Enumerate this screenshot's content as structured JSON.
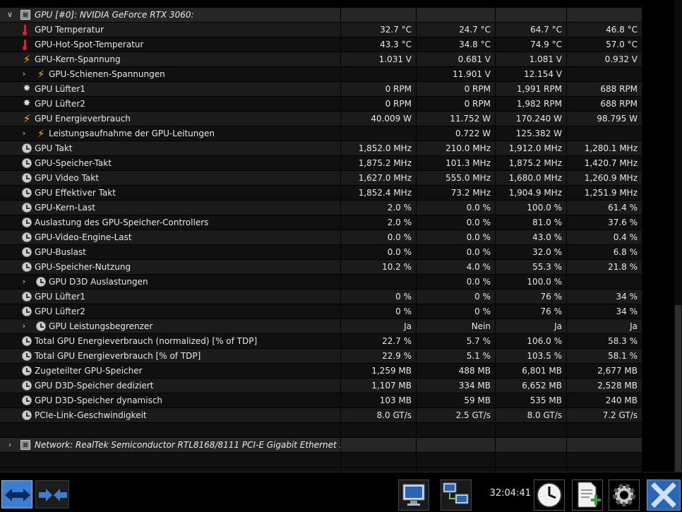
{
  "sensor_groups": {
    "gpu": {
      "title": "GPU [#0]: NVIDIA GeForce RTX 3060:",
      "rows": [
        {
          "icon": "thermometer-icon",
          "indent": 1,
          "expander": false,
          "label": "GPU Temperatur",
          "values": [
            "32.7 °C",
            "24.7 °C",
            "64.7 °C",
            "46.8 °C"
          ]
        },
        {
          "icon": "thermometer-icon",
          "indent": 1,
          "expander": false,
          "label": "GPU-Hot-Spot-Temperatur",
          "values": [
            "43.3 °C",
            "34.8 °C",
            "74.9 °C",
            "57.0 °C"
          ]
        },
        {
          "icon": "voltage-icon",
          "indent": 1,
          "expander": false,
          "label": "GPU-Kern-Spannung",
          "values": [
            "1.031 V",
            "0.681 V",
            "1.081 V",
            "0.932 V"
          ]
        },
        {
          "icon": "voltage-icon",
          "indent": 2,
          "expander": true,
          "label": "GPU-Schienen-Spannungen",
          "values": [
            "",
            "11.901 V",
            "12.154 V",
            ""
          ]
        },
        {
          "icon": "fan-icon",
          "indent": 1,
          "expander": false,
          "label": "GPU Lüfter1",
          "values": [
            "0 RPM",
            "0 RPM",
            "1,991 RPM",
            "688 RPM"
          ]
        },
        {
          "icon": "fan-icon",
          "indent": 1,
          "expander": false,
          "label": "GPU Lüfter2",
          "values": [
            "0 RPM",
            "0 RPM",
            "1,982 RPM",
            "688 RPM"
          ]
        },
        {
          "icon": "voltage-icon",
          "indent": 1,
          "expander": false,
          "label": "GPU Energieverbrauch",
          "values": [
            "40.009 W",
            "11.752 W",
            "170.240 W",
            "98.795 W"
          ]
        },
        {
          "icon": "voltage-icon",
          "indent": 2,
          "expander": true,
          "label": "Leistungsaufnahme der GPU-Leitungen",
          "values": [
            "",
            "0.722 W",
            "125.382 W",
            ""
          ]
        },
        {
          "icon": "clock-icon",
          "indent": 1,
          "expander": false,
          "label": "GPU Takt",
          "values": [
            "1,852.0 MHz",
            "210.0 MHz",
            "1,912.0 MHz",
            "1,280.1 MHz"
          ]
        },
        {
          "icon": "clock-icon",
          "indent": 1,
          "expander": false,
          "label": "GPU-Speicher-Takt",
          "values": [
            "1,875.2 MHz",
            "101.3 MHz",
            "1,875.2 MHz",
            "1,420.7 MHz"
          ]
        },
        {
          "icon": "clock-icon",
          "indent": 1,
          "expander": false,
          "label": "GPU Video Takt",
          "values": [
            "1,627.0 MHz",
            "555.0 MHz",
            "1,680.0 MHz",
            "1,260.9 MHz"
          ]
        },
        {
          "icon": "clock-icon",
          "indent": 1,
          "expander": false,
          "label": "GPU Effektiver Takt",
          "values": [
            "1,852.4 MHz",
            "73.2 MHz",
            "1,904.9 MHz",
            "1,251.9 MHz"
          ]
        },
        {
          "icon": "clock-icon",
          "indent": 1,
          "expander": false,
          "label": "GPU-Kern-Last",
          "values": [
            "2.0 %",
            "0.0 %",
            "100.0 %",
            "61.4 %"
          ]
        },
        {
          "icon": "clock-icon",
          "indent": 1,
          "expander": false,
          "label": "Auslastung des GPU-Speicher-Controllers",
          "values": [
            "2.0 %",
            "0.0 %",
            "81.0 %",
            "37.6 %"
          ]
        },
        {
          "icon": "clock-icon",
          "indent": 1,
          "expander": false,
          "label": "GPU-Video-Engine-Last",
          "values": [
            "0.0 %",
            "0.0 %",
            "43.0 %",
            "0.4 %"
          ]
        },
        {
          "icon": "clock-icon",
          "indent": 1,
          "expander": false,
          "label": "GPU-Buslast",
          "values": [
            "0.0 %",
            "0.0 %",
            "32.0 %",
            "6.8 %"
          ]
        },
        {
          "icon": "clock-icon",
          "indent": 1,
          "expander": false,
          "label": "GPU-Speicher-Nutzung",
          "values": [
            "10.2 %",
            "4.0 %",
            "55.3 %",
            "21.8 %"
          ]
        },
        {
          "icon": "clock-icon",
          "indent": 2,
          "expander": true,
          "label": "GPU D3D Auslastungen",
          "values": [
            "",
            "0.0 %",
            "100.0 %",
            ""
          ]
        },
        {
          "icon": "clock-icon",
          "indent": 1,
          "expander": false,
          "label": "GPU Lüfter1",
          "values": [
            "0 %",
            "0 %",
            "76 %",
            "34 %"
          ]
        },
        {
          "icon": "clock-icon",
          "indent": 1,
          "expander": false,
          "label": "GPU Lüfter2",
          "values": [
            "0 %",
            "0 %",
            "76 %",
            "34 %"
          ]
        },
        {
          "icon": "clock-icon",
          "indent": 2,
          "expander": true,
          "label": "GPU Leistungsbegrenzer",
          "values": [
            "Ja",
            "Nein",
            "Ja",
            "Ja"
          ]
        },
        {
          "icon": "clock-icon",
          "indent": 1,
          "expander": false,
          "label": "Total GPU Energieverbrauch (normalized) [% of TDP]",
          "values": [
            "22.7 %",
            "5.7 %",
            "106.0 %",
            "58.3 %"
          ]
        },
        {
          "icon": "clock-icon",
          "indent": 1,
          "expander": false,
          "label": "Total GPU Energieverbrauch [% of TDP]",
          "values": [
            "22.9 %",
            "5.1 %",
            "103.5 %",
            "58.1 %"
          ]
        },
        {
          "icon": "clock-icon",
          "indent": 1,
          "expander": false,
          "label": "Zugeteilter GPU-Speicher",
          "values": [
            "1,259 MB",
            "488 MB",
            "6,801 MB",
            "2,677 MB"
          ]
        },
        {
          "icon": "clock-icon",
          "indent": 1,
          "expander": false,
          "label": "GPU D3D-Speicher dediziert",
          "values": [
            "1,107 MB",
            "334 MB",
            "6,652 MB",
            "2,528 MB"
          ]
        },
        {
          "icon": "clock-icon",
          "indent": 1,
          "expander": false,
          "label": "GPU D3D-Speicher dynamisch",
          "values": [
            "103 MB",
            "59 MB",
            "535 MB",
            "240 MB"
          ]
        },
        {
          "icon": "clock-icon",
          "indent": 1,
          "expander": false,
          "label": "PCIe-Link-Geschwindigkeit",
          "values": [
            "8.0 GT/s",
            "2.5 GT/s",
            "8.0 GT/s",
            "7.2 GT/s"
          ]
        }
      ]
    },
    "network": {
      "title": "Network: RealTek Semiconductor RTL8168/8111 PCI-E Gigabit Ethernet ..."
    }
  },
  "toolbar": {
    "elapsed_time": "32:04:41"
  },
  "colors": {
    "voltage_icon": "#ffb400",
    "thermometer_icon": "#e0202a",
    "accent_blue": "#3a7fd2"
  }
}
